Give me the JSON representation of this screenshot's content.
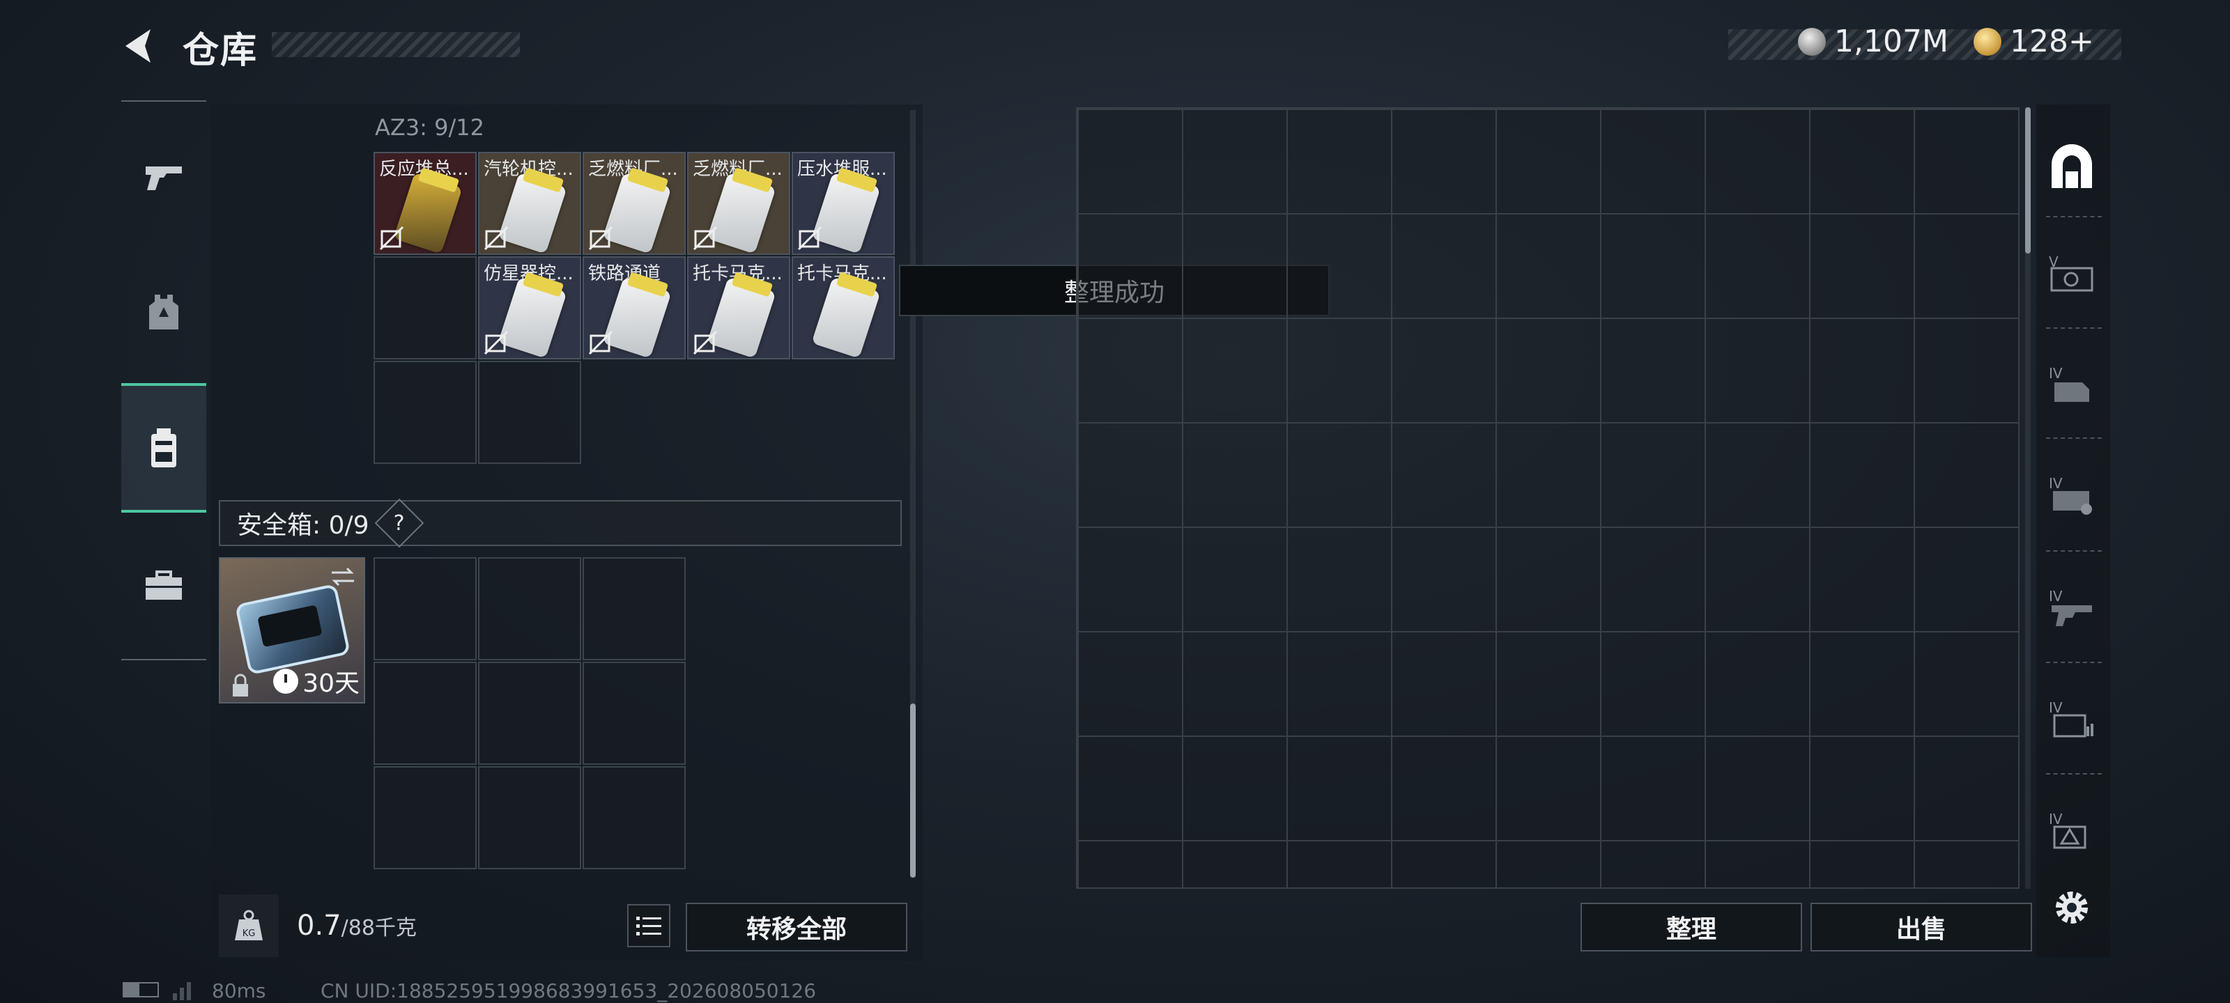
{
  "header": {
    "title": "仓库",
    "currency_1": "1,107M",
    "currency_2": "128+"
  },
  "nav": {
    "items": [
      "weapon-icon",
      "armor-icon",
      "backpack-icon",
      "toolbox-icon"
    ],
    "active_index": 2
  },
  "container": {
    "label": "AZ3: 9/12",
    "items": [
      {
        "name": "反应堆总...",
        "color": "#3a1e22"
      },
      {
        "name": "汽轮机控...",
        "color": "#4a4236"
      },
      {
        "name": "乏燃料厂...",
        "color": "#4a4236"
      },
      {
        "name": "乏燃料厂...",
        "color": "#4a4236"
      },
      {
        "name": "压水堆服...",
        "color": "#2f3446"
      },
      {
        "name": "仿星器控...",
        "color": "#2f3446"
      },
      {
        "name": "铁路通道",
        "color": "#2f3446"
      },
      {
        "name": "托卡马克...",
        "color": "#2f3446"
      },
      {
        "name": "托卡马克...",
        "color": "#2f3446"
      }
    ]
  },
  "safebox": {
    "label": "安全箱: 0/9",
    "help": "?",
    "days": "30天"
  },
  "footer": {
    "weight_value": "0.7",
    "weight_max": "/88千克",
    "transfer_all": "转移全部",
    "sort": "整理",
    "sell": "出售"
  },
  "toast": "整理成功",
  "status": {
    "ping": "80ms",
    "uid": "CN UID:188525951998683991653_202608050126"
  }
}
